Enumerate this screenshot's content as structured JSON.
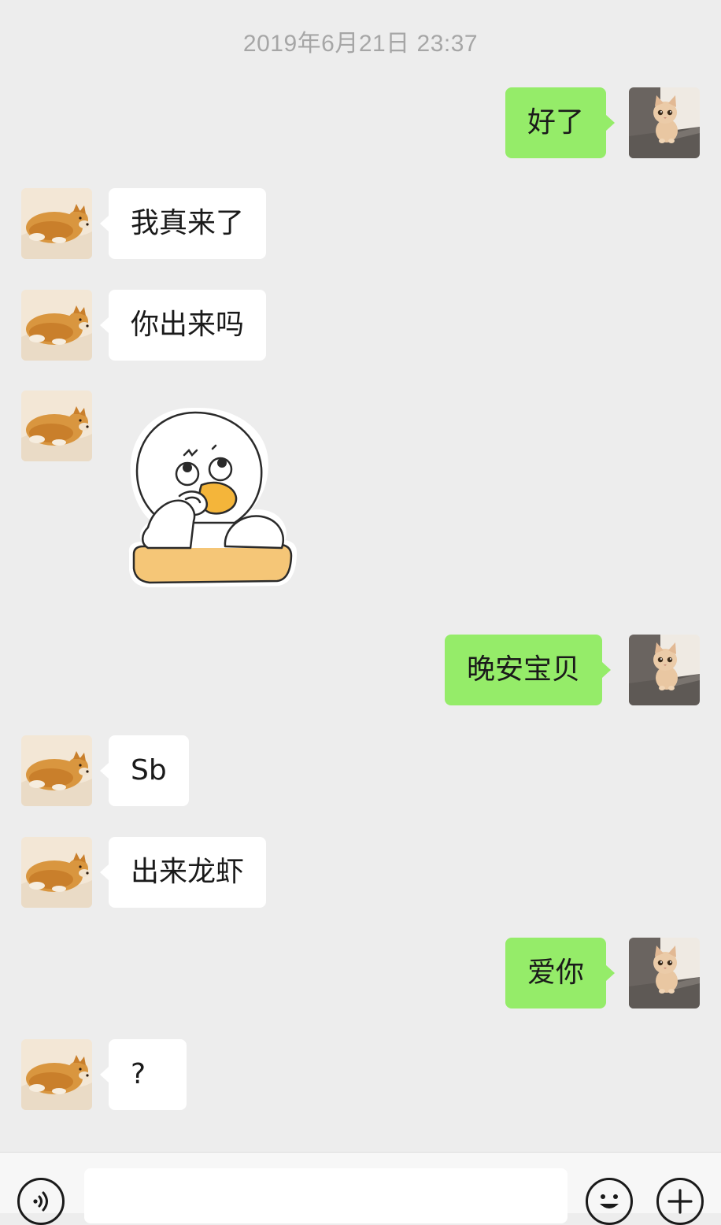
{
  "conversation": {
    "timestamp": "2019年6月21日 23:37",
    "messages": [
      {
        "sender": "self",
        "type": "text",
        "text": "好了"
      },
      {
        "sender": "other",
        "type": "text",
        "text": "我真来了"
      },
      {
        "sender": "other",
        "type": "text",
        "text": "你出来吗"
      },
      {
        "sender": "other",
        "type": "sticker",
        "sticker": "duck-thinking-sticker"
      },
      {
        "sender": "self",
        "type": "text",
        "text": "晚安宝贝"
      },
      {
        "sender": "other",
        "type": "text",
        "text": "Sb"
      },
      {
        "sender": "other",
        "type": "text",
        "text": "出来龙虾"
      },
      {
        "sender": "self",
        "type": "text",
        "text": "爱你"
      },
      {
        "sender": "other",
        "type": "text",
        "text": "?"
      }
    ]
  },
  "avatars": {
    "self": "cat-avatar",
    "other": "shiba-dog-avatar"
  },
  "input_bar": {
    "text_value": "",
    "voice_icon": "voice-icon",
    "emoji_icon": "emoji-icon",
    "more_icon": "plus-icon"
  },
  "colors": {
    "background": "#EDEDED",
    "outgoing_bubble": "#95EC69",
    "incoming_bubble": "#FFFFFF",
    "timestamp_text": "#A6A6A6"
  }
}
